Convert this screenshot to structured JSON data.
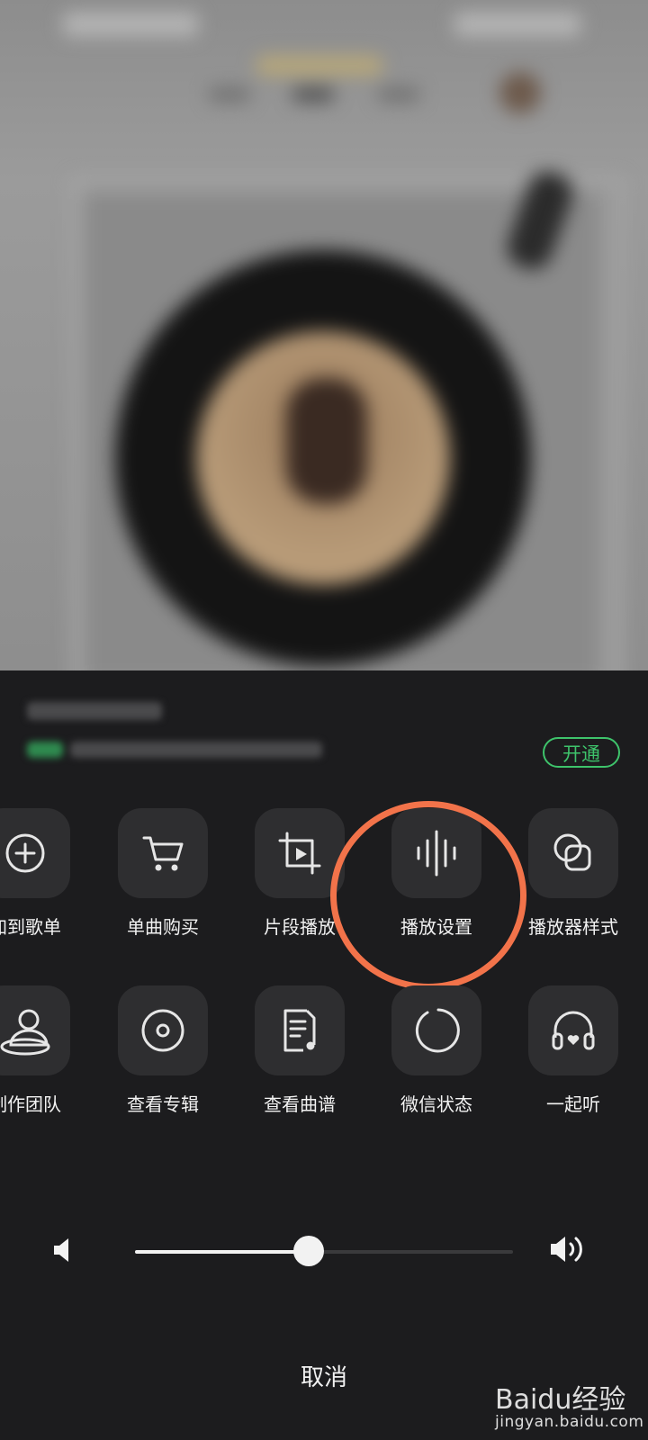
{
  "background": {
    "description_hidden": ""
  },
  "vip_banner": {
    "open_button": "开通",
    "accent_color": "#3ec36b"
  },
  "actions_row1": [
    {
      "label": "加到歌单",
      "icon": "add-circle-icon"
    },
    {
      "label": "单曲购买",
      "icon": "cart-icon"
    },
    {
      "label": "片段播放",
      "icon": "crop-play-icon"
    },
    {
      "label": "播放设置",
      "icon": "waveform-icon"
    },
    {
      "label": "播放器样式",
      "icon": "overlap-squares-icon"
    }
  ],
  "actions_row2": [
    {
      "label": "制作团队",
      "icon": "team-icon"
    },
    {
      "label": "查看专辑",
      "icon": "album-disc-icon"
    },
    {
      "label": "查看曲谱",
      "icon": "sheet-music-icon"
    },
    {
      "label": "微信状态",
      "icon": "status-ring-icon"
    },
    {
      "label": "一起听",
      "icon": "headphones-heart-icon"
    }
  ],
  "volume": {
    "level": 0.46,
    "low_icon": "volume-low-icon",
    "high_icon": "volume-high-icon"
  },
  "cancel_label": "取消",
  "highlight_color": "#f2734a",
  "watermark": {
    "brand": "Baidu经验",
    "url": "jingyan.baidu.com"
  }
}
